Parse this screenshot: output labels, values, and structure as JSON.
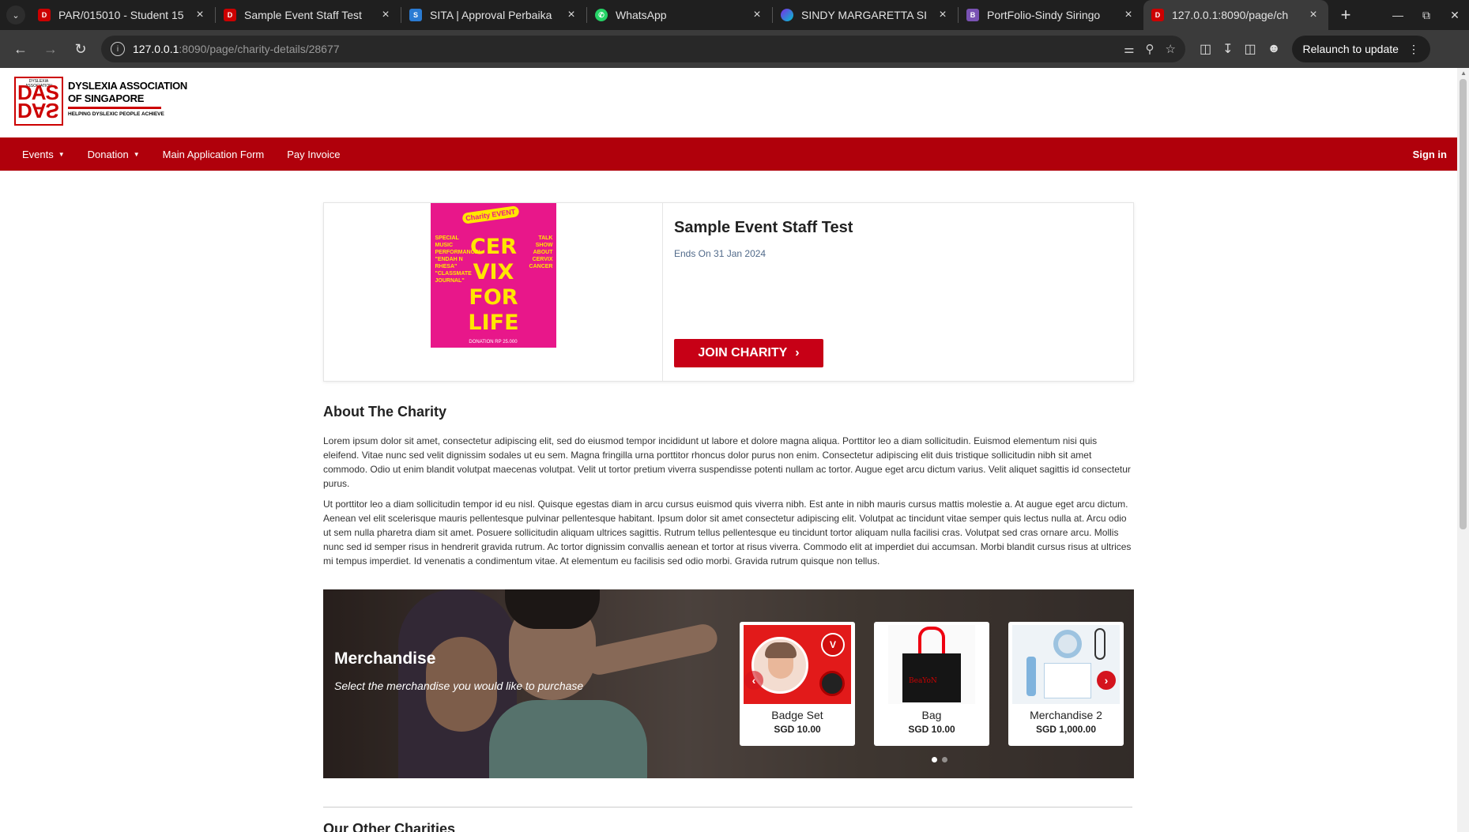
{
  "browser": {
    "tabs": [
      {
        "title": "PAR/015010 - Student 15",
        "favicon": "das-logo",
        "active": false
      },
      {
        "title": "Sample Event Staff Test",
        "favicon": "das-logo",
        "active": false
      },
      {
        "title": "SITA | Approval Perbaika",
        "favicon": "sita-logo",
        "active": false
      },
      {
        "title": "WhatsApp",
        "favicon": "whatsapp-icon",
        "active": false
      },
      {
        "title": "SINDY MARGARETTA SI",
        "favicon": "canva-icon",
        "active": false
      },
      {
        "title": "PortFolio-Sindy Siringo",
        "favicon": "bootstrap-icon",
        "active": false
      },
      {
        "title": "127.0.0.1:8090/page/ch",
        "favicon": "das-logo",
        "active": true
      }
    ],
    "url_host": "127.0.0.1",
    "url_path": ":8090/page/charity-details/28677",
    "relaunch_label": "Relaunch to update"
  },
  "site": {
    "logo": {
      "small_top": "DYSLEXIA ASSOCIATION",
      "mark_top": "DAS",
      "mark_bottom": "DAS",
      "small_bottom": "OF SINGAPORE",
      "line1": "DYSLEXIA ASSOCIATION",
      "line2": "OF SINGAPORE",
      "tagline": "HELPING DYSLEXIC PEOPLE ACHIEVE"
    },
    "nav": {
      "events": "Events",
      "donation": "Donation",
      "main_form": "Main Application Form",
      "pay_invoice": "Pay Invoice",
      "sign_in": "Sign in"
    }
  },
  "event": {
    "title": "Sample Event Staff Test",
    "ends": "Ends On 31 Jan 2024",
    "join_label": "JOIN CHARITY",
    "poster": {
      "tag": "Charity EVENT",
      "headline": "CER VIX FOR LIFE",
      "left_text": "SPECIAL MUSIC PERFORMANCE! \"ENDAH N RHESA\" \"CLASSMATE JOURNAL\"",
      "right_text": "TALK SHOW ABOUT CERVIX CANCER",
      "donation": "DONATION RP 25.000"
    }
  },
  "about": {
    "title": "About The Charity",
    "p1": "Lorem ipsum dolor sit amet, consectetur adipiscing elit, sed do eiusmod tempor incididunt ut labore et dolore magna aliqua. Porttitor leo a diam sollicitudin. Euismod elementum nisi quis eleifend. Vitae nunc sed velit dignissim sodales ut eu sem. Magna fringilla urna porttitor rhoncus dolor purus non enim. Consectetur adipiscing elit duis tristique sollicitudin nibh sit amet commodo. Odio ut enim blandit volutpat maecenas volutpat. Velit ut tortor pretium viverra suspendisse potenti nullam ac tortor. Augue eget arcu dictum varius. Velit aliquet sagittis id consectetur purus.",
    "p2": "Ut porttitor leo a diam sollicitudin tempor id eu nisl. Quisque egestas diam in arcu cursus euismod quis viverra nibh. Est ante in nibh mauris cursus mattis molestie a. At augue eget arcu dictum. Aenean vel elit scelerisque mauris pellentesque pulvinar pellentesque habitant. Ipsum dolor sit amet consectetur adipiscing elit. Volutpat ac tincidunt vitae semper quis lectus nulla at. Arcu odio ut sem nulla pharetra diam sit amet. Posuere sollicitudin aliquam ultrices sagittis. Rutrum tellus pellentesque eu tincidunt tortor aliquam nulla facilisi cras. Volutpat sed cras ornare arcu. Mollis nunc sed id semper risus in hendrerit gravida rutrum. Ac tortor dignissim convallis aenean et tortor at risus viverra. Commodo elit at imperdiet dui accumsan. Morbi blandit cursus risus at ultrices mi tempus imperdiet. Id venenatis a condimentum vitae. At elementum eu facilisis sed odio morbi. Gravida rutrum quisque non tellus."
  },
  "merchandise": {
    "title": "Merchandise",
    "subtitle": "Select the merchandise you would like to purchase",
    "items": [
      {
        "name": "Badge Set",
        "price": "SGD 10.00"
      },
      {
        "name": "Bag",
        "price": "SGD 10.00"
      },
      {
        "name": "Merchandise 2",
        "price": "SGD 1,000.00"
      }
    ],
    "bag_logo": "BeaYoN",
    "badge_logo": "V",
    "carousel_pages": 2,
    "carousel_active": 1
  },
  "other": {
    "title": "Our Other Charities"
  }
}
